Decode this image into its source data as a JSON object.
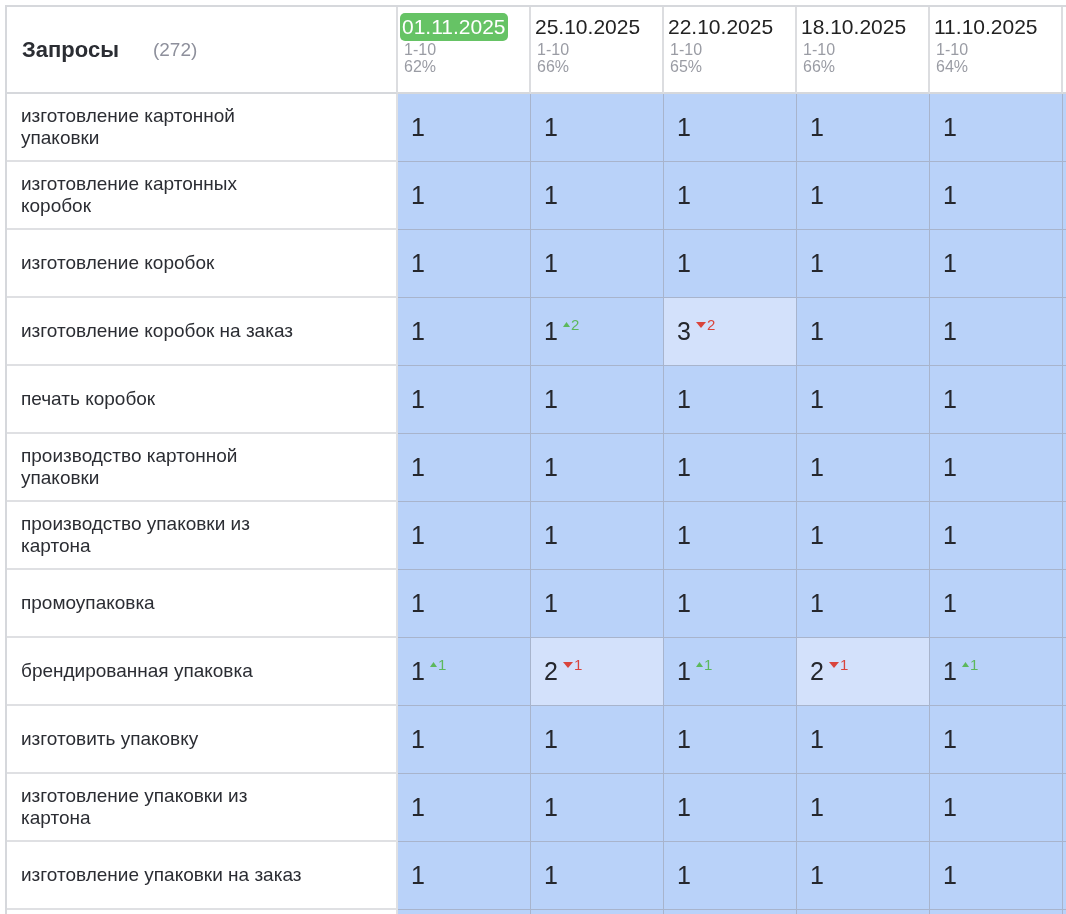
{
  "table": {
    "title": "Запросы",
    "count": "(272)",
    "columns": [
      {
        "date": "01.11.2025",
        "selected": true,
        "range": "1-10",
        "share": "62%"
      },
      {
        "date": "25.10.2025",
        "selected": false,
        "range": "1-10",
        "share": "66%"
      },
      {
        "date": "22.10.2025",
        "selected": false,
        "range": "1-10",
        "share": "65%"
      },
      {
        "date": "18.10.2025",
        "selected": false,
        "range": "1-10",
        "share": "66%"
      },
      {
        "date": "11.10.2025",
        "selected": false,
        "range": "1-10",
        "share": "64%"
      }
    ],
    "rows": [
      {
        "query": "изготовление картонной упаковки",
        "cells": [
          {
            "value": "1",
            "color": "#b9d2f9"
          },
          {
            "value": "1",
            "color": "#b9d2f9"
          },
          {
            "value": "1",
            "color": "#b9d2f9"
          },
          {
            "value": "1",
            "color": "#b9d2f9"
          },
          {
            "value": "1",
            "color": "#b9d2f9"
          }
        ]
      },
      {
        "query": "изготовление картонных коробок",
        "cells": [
          {
            "value": "1",
            "color": "#b9d2f9"
          },
          {
            "value": "1",
            "color": "#b9d2f9"
          },
          {
            "value": "1",
            "color": "#b9d2f9"
          },
          {
            "value": "1",
            "color": "#b9d2f9"
          },
          {
            "value": "1",
            "color": "#b9d2f9"
          }
        ]
      },
      {
        "query": "изготовление коробок",
        "cells": [
          {
            "value": "1",
            "color": "#b9d2f9"
          },
          {
            "value": "1",
            "color": "#b9d2f9"
          },
          {
            "value": "1",
            "color": "#b9d2f9"
          },
          {
            "value": "1",
            "color": "#b9d2f9"
          },
          {
            "value": "1",
            "color": "#b9d2f9"
          }
        ]
      },
      {
        "query": "изготовление коробок на заказ",
        "cells": [
          {
            "value": "1",
            "color": "#b9d2f9"
          },
          {
            "value": "1",
            "color": "#b9d2f9",
            "change": {
              "rising": true,
              "amount": "2"
            }
          },
          {
            "value": "3",
            "color": "#d3e1fb",
            "change": {
              "rising": false,
              "amount": "2"
            }
          },
          {
            "value": "1",
            "color": "#b9d2f9"
          },
          {
            "value": "1",
            "color": "#b9d2f9"
          }
        ]
      },
      {
        "query": "печать коробок",
        "cells": [
          {
            "value": "1",
            "color": "#b9d2f9"
          },
          {
            "value": "1",
            "color": "#b9d2f9"
          },
          {
            "value": "1",
            "color": "#b9d2f9"
          },
          {
            "value": "1",
            "color": "#b9d2f9"
          },
          {
            "value": "1",
            "color": "#b9d2f9"
          }
        ]
      },
      {
        "query": "производство картонной упаковки",
        "cells": [
          {
            "value": "1",
            "color": "#b9d2f9"
          },
          {
            "value": "1",
            "color": "#b9d2f9"
          },
          {
            "value": "1",
            "color": "#b9d2f9"
          },
          {
            "value": "1",
            "color": "#b9d2f9"
          },
          {
            "value": "1",
            "color": "#b9d2f9"
          }
        ]
      },
      {
        "query": "производство упаковки из картона",
        "cells": [
          {
            "value": "1",
            "color": "#b9d2f9"
          },
          {
            "value": "1",
            "color": "#b9d2f9"
          },
          {
            "value": "1",
            "color": "#b9d2f9"
          },
          {
            "value": "1",
            "color": "#b9d2f9"
          },
          {
            "value": "1",
            "color": "#b9d2f9"
          }
        ]
      },
      {
        "query": "промоупаковка",
        "cells": [
          {
            "value": "1",
            "color": "#b9d2f9"
          },
          {
            "value": "1",
            "color": "#b9d2f9"
          },
          {
            "value": "1",
            "color": "#b9d2f9"
          },
          {
            "value": "1",
            "color": "#b9d2f9"
          },
          {
            "value": "1",
            "color": "#b9d2f9"
          }
        ]
      },
      {
        "query": "брендированная упаковка",
        "cells": [
          {
            "value": "1",
            "color": "#b9d2f9",
            "change": {
              "rising": true,
              "amount": "1"
            }
          },
          {
            "value": "2",
            "color": "#d3e1fb",
            "change": {
              "rising": false,
              "amount": "1"
            }
          },
          {
            "value": "1",
            "color": "#b9d2f9",
            "change": {
              "rising": true,
              "amount": "1"
            }
          },
          {
            "value": "2",
            "color": "#d3e1fb",
            "change": {
              "rising": false,
              "amount": "1"
            }
          },
          {
            "value": "1",
            "color": "#b9d2f9",
            "change": {
              "rising": true,
              "amount": "1"
            }
          }
        ]
      },
      {
        "query": "изготовить упаковку",
        "cells": [
          {
            "value": "1",
            "color": "#b9d2f9"
          },
          {
            "value": "1",
            "color": "#b9d2f9"
          },
          {
            "value": "1",
            "color": "#b9d2f9"
          },
          {
            "value": "1",
            "color": "#b9d2f9"
          },
          {
            "value": "1",
            "color": "#b9d2f9"
          }
        ]
      },
      {
        "query": "изготовление упаковки из картона",
        "cells": [
          {
            "value": "1",
            "color": "#b9d2f9"
          },
          {
            "value": "1",
            "color": "#b9d2f9"
          },
          {
            "value": "1",
            "color": "#b9d2f9"
          },
          {
            "value": "1",
            "color": "#b9d2f9"
          },
          {
            "value": "1",
            "color": "#b9d2f9"
          }
        ]
      },
      {
        "query": "изготовление упаковки на заказ",
        "cells": [
          {
            "value": "1",
            "color": "#b9d2f9"
          },
          {
            "value": "1",
            "color": "#b9d2f9"
          },
          {
            "value": "1",
            "color": "#b9d2f9"
          },
          {
            "value": "1",
            "color": "#b9d2f9"
          },
          {
            "value": "1",
            "color": "#b9d2f9"
          }
        ]
      }
    ]
  }
}
